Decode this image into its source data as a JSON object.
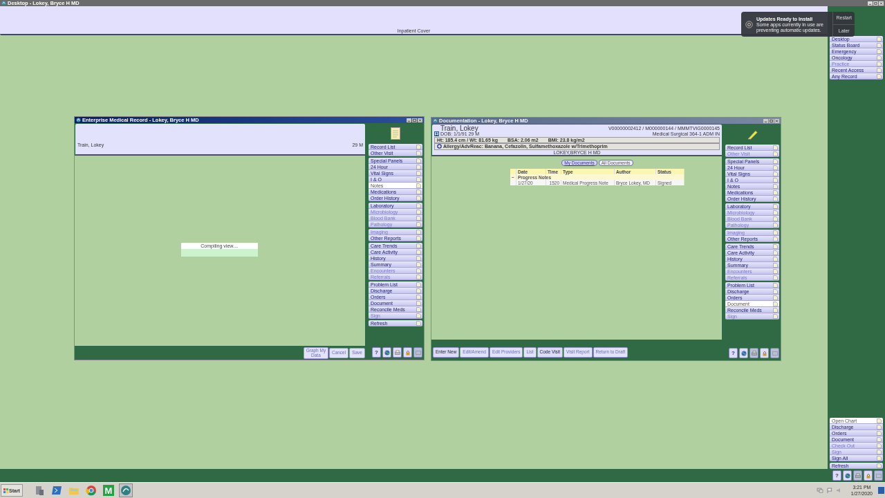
{
  "desktop": {
    "title": "Desktop - Lokey, Bryce H MD",
    "header_label": "Inpatient Cover",
    "nav_top": [
      {
        "label": "Desktop",
        "disabled": false,
        "selected": false
      },
      {
        "label": "Status Board",
        "disabled": false,
        "selected": false
      },
      {
        "label": "Emergency",
        "disabled": false,
        "selected": false
      },
      {
        "label": "Oncology",
        "disabled": false,
        "selected": false
      },
      {
        "label": "Practice",
        "disabled": true,
        "selected": false
      },
      {
        "label": "Recent Access",
        "disabled": false,
        "selected": false
      },
      {
        "label": "Any Record",
        "disabled": false,
        "selected": false
      }
    ],
    "nav_bottom": [
      [
        {
          "label": "Open Chart",
          "disabled": false,
          "selected": true
        },
        {
          "label": "Discharge",
          "disabled": false,
          "selected": false
        },
        {
          "label": "Orders",
          "disabled": false,
          "selected": false
        },
        {
          "label": "Document",
          "disabled": false,
          "selected": false
        },
        {
          "label": "Check Out",
          "disabled": true,
          "selected": false
        },
        {
          "label": "Sign",
          "disabled": true,
          "selected": false
        },
        {
          "label": "Sign All",
          "disabled": false,
          "selected": false
        }
      ],
      [
        {
          "label": "Refresh",
          "disabled": false,
          "selected": false
        }
      ]
    ],
    "tool_buttons": [
      {
        "kind": "help",
        "label": "?",
        "disabled": false
      },
      {
        "kind": "globe",
        "disabled": false
      },
      {
        "kind": "printer",
        "disabled": true
      },
      {
        "kind": "lock",
        "disabled": false
      },
      {
        "kind": "blank",
        "disabled": true
      }
    ]
  },
  "notification": {
    "title": "Updates Ready to Install",
    "message": "Some apps currently in use are preventing automatic updates.",
    "actions": [
      "Restart",
      "Later"
    ]
  },
  "windows": [
    {
      "kind": "emr",
      "active": true,
      "title": "Enterprise Medical Record - Lokey, Bryce H MD",
      "patient": "Train, Lokey",
      "age_sex": "29 M",
      "progress": "Compiling view....",
      "nav": [
        [
          {
            "label": "Record List",
            "disabled": false,
            "selected": false
          },
          {
            "label": "Other Visit",
            "disabled": false,
            "selected": false
          }
        ],
        [
          {
            "label": "Special Panels",
            "disabled": false,
            "selected": false
          },
          {
            "label": "24 Hour",
            "disabled": false,
            "selected": false
          },
          {
            "label": "Vital Signs",
            "disabled": false,
            "selected": false
          },
          {
            "label": "I & O",
            "disabled": false,
            "selected": false
          },
          {
            "label": "Notes",
            "disabled": false,
            "selected": true
          },
          {
            "label": "Medications",
            "disabled": false,
            "selected": false
          },
          {
            "label": "Order History",
            "disabled": false,
            "selected": false
          }
        ],
        [
          {
            "label": "Laboratory",
            "disabled": false,
            "selected": false
          },
          {
            "label": "Microbiology",
            "disabled": true,
            "selected": false
          },
          {
            "label": "Blood Bank",
            "disabled": true,
            "selected": false
          },
          {
            "label": "Pathology",
            "disabled": true,
            "selected": false
          }
        ],
        [
          {
            "label": "Imaging",
            "disabled": true,
            "selected": false
          },
          {
            "label": "Other Reports",
            "disabled": false,
            "selected": false
          }
        ],
        [
          {
            "label": "Care Trends",
            "disabled": false,
            "selected": false
          },
          {
            "label": "Care Activity",
            "disabled": false,
            "selected": false
          },
          {
            "label": "History",
            "disabled": false,
            "selected": false
          },
          {
            "label": "Summary",
            "disabled": false,
            "selected": false
          },
          {
            "label": "Encounters",
            "disabled": true,
            "selected": false
          },
          {
            "label": "Referrals",
            "disabled": true,
            "selected": false
          }
        ],
        [
          {
            "label": "Problem List",
            "disabled": false,
            "selected": false
          },
          {
            "label": "Discharge",
            "disabled": false,
            "selected": false
          },
          {
            "label": "Orders",
            "disabled": false,
            "selected": false
          },
          {
            "label": "Document",
            "disabled": false,
            "selected": false
          },
          {
            "label": "Reconcile Meds",
            "disabled": false,
            "selected": false
          },
          {
            "label": "Sign",
            "disabled": true,
            "selected": false
          }
        ],
        [
          {
            "label": "Refresh",
            "disabled": false,
            "selected": false
          }
        ]
      ],
      "actions": [
        {
          "label": "Graph My Data",
          "disabled": true
        },
        {
          "label": "Cancel",
          "disabled": true
        },
        {
          "label": "Save",
          "disabled": true
        }
      ],
      "tool_buttons": [
        {
          "kind": "help",
          "label": "?",
          "disabled": false
        },
        {
          "kind": "globe",
          "disabled": false
        },
        {
          "kind": "printer",
          "disabled": false
        },
        {
          "kind": "lock",
          "disabled": false
        },
        {
          "kind": "blank",
          "disabled": true
        }
      ]
    },
    {
      "kind": "doc",
      "active": false,
      "title": "Documentation - Lokey, Bryce H MD",
      "patient": "Train, Lokey",
      "dob": "DOB: 1/1/91 29 M",
      "height_weight": "Ht: 185.4 cm / Wt: 81.65 kg",
      "bsa": "BSA: 2.06 m2",
      "bmi": "BMI: 23.8 kg/m2",
      "allergy": "Allergy/AdvReac: Banana, Cefazolin, Sulfamethoxazole w/Trimethoprim",
      "provider": "LOKEY,BRYCE H MD",
      "ids": "V00000002412 / M000000144 / MMMTVIG0000145",
      "location": "Medical Surgical 364-1  ADM IN",
      "tabs": [
        {
          "label": "My Documents",
          "selected": true
        },
        {
          "label": "All Documents",
          "selected": false
        }
      ],
      "table": {
        "columns": [
          "Date",
          "Time",
          "Type",
          "Author",
          "Status"
        ],
        "groups": [
          {
            "label": "Progress Notes",
            "expanded": true,
            "marker": "−",
            "rows": [
              [
                "1/27/20",
                "1520",
                "Medical Progress Note",
                "Bryce Lokey, MD",
                "Signed"
              ]
            ]
          }
        ]
      },
      "nav": [
        [
          {
            "label": "Record List",
            "disabled": false,
            "selected": false
          },
          {
            "label": "Other Visit",
            "disabled": true,
            "selected": false
          }
        ],
        [
          {
            "label": "Special Panels",
            "disabled": false,
            "selected": false
          },
          {
            "label": "24 Hour",
            "disabled": false,
            "selected": false
          },
          {
            "label": "Vital Signs",
            "disabled": false,
            "selected": false
          },
          {
            "label": "I & O",
            "disabled": false,
            "selected": false
          },
          {
            "label": "Notes",
            "disabled": false,
            "selected": false
          },
          {
            "label": "Medications",
            "disabled": false,
            "selected": false
          },
          {
            "label": "Order History",
            "disabled": false,
            "selected": false
          }
        ],
        [
          {
            "label": "Laboratory",
            "disabled": false,
            "selected": false
          },
          {
            "label": "Microbiology",
            "disabled": true,
            "selected": false
          },
          {
            "label": "Blood Bank",
            "disabled": true,
            "selected": false
          },
          {
            "label": "Pathology",
            "disabled": true,
            "selected": false
          }
        ],
        [
          {
            "label": "Imaging",
            "disabled": true,
            "selected": false
          },
          {
            "label": "Other Reports",
            "disabled": false,
            "selected": false
          }
        ],
        [
          {
            "label": "Care Trends",
            "disabled": false,
            "selected": false
          },
          {
            "label": "Care Activity",
            "disabled": false,
            "selected": false
          },
          {
            "label": "History",
            "disabled": false,
            "selected": false
          },
          {
            "label": "Summary",
            "disabled": false,
            "selected": false
          },
          {
            "label": "Encounters",
            "disabled": true,
            "selected": false
          },
          {
            "label": "Referrals",
            "disabled": true,
            "selected": false
          }
        ],
        [
          {
            "label": "Problem List",
            "disabled": false,
            "selected": false
          },
          {
            "label": "Discharge",
            "disabled": false,
            "selected": false
          },
          {
            "label": "Orders",
            "disabled": false,
            "selected": false
          },
          {
            "label": "Document",
            "disabled": false,
            "selected": true
          },
          {
            "label": "Reconcile Meds",
            "disabled": false,
            "selected": false
          },
          {
            "label": "Sign",
            "disabled": true,
            "selected": false
          }
        ]
      ],
      "actions": [
        {
          "label": "Enter New",
          "disabled": false
        },
        {
          "label": "Edit/Amend",
          "disabled": true
        },
        {
          "label": "Edit Providers",
          "disabled": true
        },
        {
          "label": "List",
          "disabled": true
        },
        {
          "label": "Code Visit",
          "disabled": false
        },
        {
          "label": "Visit Report",
          "disabled": true
        },
        {
          "label": "Return to Draft",
          "disabled": true
        }
      ],
      "tool_buttons": [
        {
          "kind": "help",
          "label": "?",
          "disabled": false
        },
        {
          "kind": "globe",
          "disabled": false
        },
        {
          "kind": "printer",
          "disabled": true
        },
        {
          "kind": "lock",
          "disabled": false
        },
        {
          "kind": "blank",
          "disabled": true
        }
      ]
    }
  ],
  "taskbar": {
    "start": "Start",
    "apps": [
      {
        "kind": "server",
        "selected": false
      },
      {
        "kind": "terminal",
        "selected": false
      },
      {
        "kind": "folder",
        "selected": false
      },
      {
        "kind": "browser",
        "selected": false
      },
      {
        "kind": "letter",
        "label": "M",
        "selected": false
      },
      {
        "kind": "emr",
        "selected": true
      }
    ],
    "time": "3:21 PM",
    "date": "1/27/2020"
  }
}
